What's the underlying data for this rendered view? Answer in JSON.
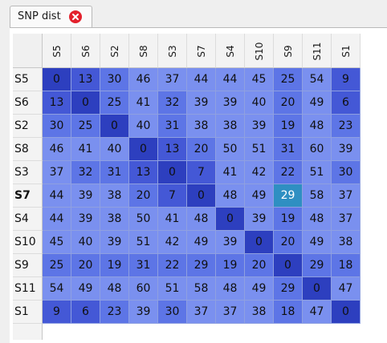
{
  "tab": {
    "title": "SNP dist",
    "close_icon": "close-icon"
  },
  "labels": [
    "S5",
    "S6",
    "S2",
    "S8",
    "S3",
    "S7",
    "S4",
    "S10",
    "S9",
    "S11",
    "S1"
  ],
  "bold_row": "S7",
  "matrix": [
    [
      0,
      13,
      30,
      46,
      37,
      44,
      44,
      45,
      25,
      54,
      9
    ],
    [
      13,
      0,
      25,
      41,
      32,
      39,
      39,
      40,
      20,
      49,
      6
    ],
    [
      30,
      25,
      0,
      40,
      31,
      38,
      38,
      39,
      19,
      48,
      23
    ],
    [
      46,
      41,
      40,
      0,
      13,
      20,
      50,
      51,
      31,
      60,
      39
    ],
    [
      37,
      32,
      31,
      13,
      0,
      7,
      41,
      42,
      22,
      51,
      30
    ],
    [
      44,
      39,
      38,
      20,
      7,
      0,
      48,
      49,
      29,
      58,
      37
    ],
    [
      44,
      39,
      38,
      50,
      41,
      48,
      0,
      39,
      19,
      48,
      37
    ],
    [
      45,
      40,
      39,
      51,
      42,
      49,
      39,
      0,
      20,
      49,
      38
    ],
    [
      25,
      20,
      19,
      31,
      22,
      29,
      19,
      20,
      0,
      29,
      18
    ],
    [
      54,
      49,
      48,
      60,
      51,
      58,
      48,
      49,
      29,
      0,
      47
    ],
    [
      9,
      6,
      23,
      39,
      30,
      37,
      37,
      38,
      18,
      47,
      0
    ]
  ],
  "selected_cell": {
    "row": 5,
    "col": 8
  },
  "colors": {
    "zero": "#2d3fbf",
    "low": "#4458d6",
    "mid": "#5d75e6",
    "high": "#7a90ef",
    "selected": "#2f8fc2"
  }
}
